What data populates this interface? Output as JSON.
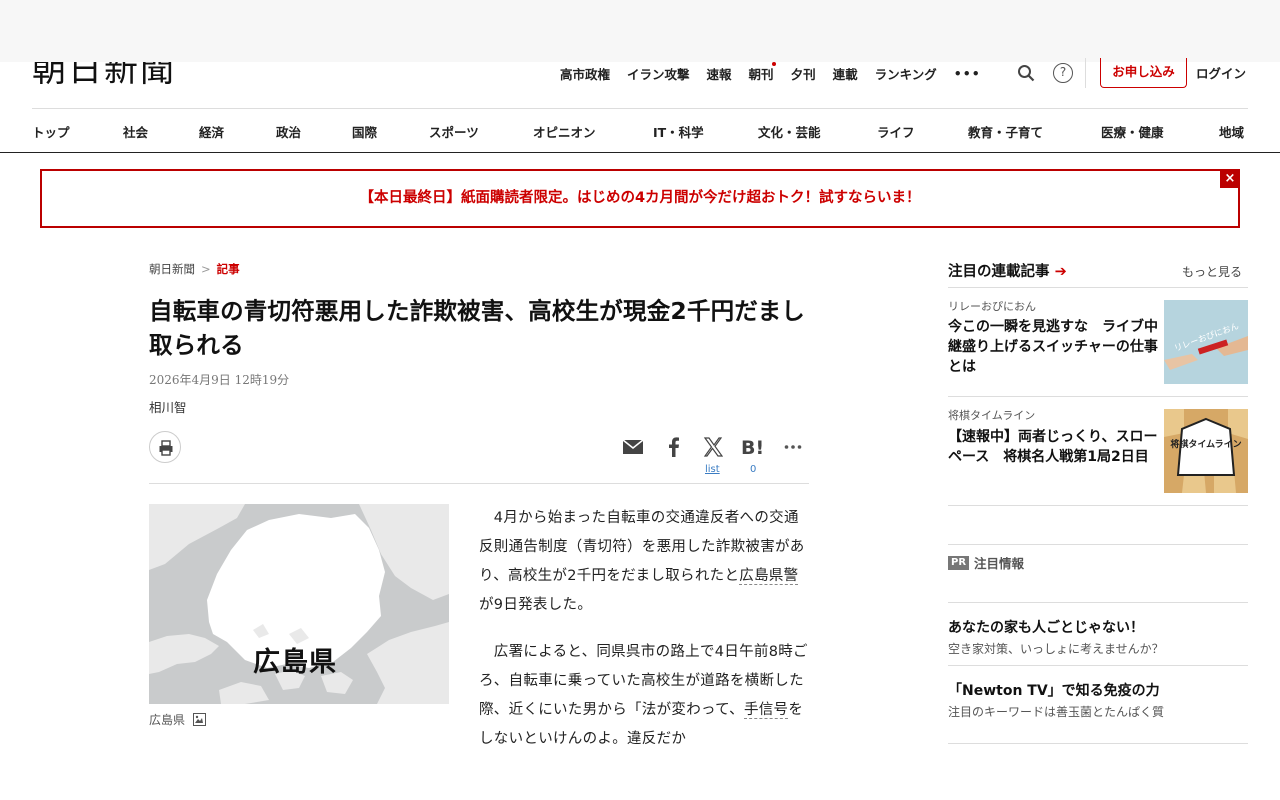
{
  "header": {
    "logo": "朝日新聞",
    "util_nav": [
      "高市政権",
      "イラン攻撃",
      "速報",
      "朝刊",
      "夕刊",
      "連載",
      "ランキング"
    ],
    "more": "•••",
    "help": "?",
    "subscribe": "お申し込み",
    "login": "ログイン"
  },
  "categories": [
    "トップ",
    "社会",
    "経済",
    "政治",
    "国際",
    "スポーツ",
    "オピニオン",
    "IT・科学",
    "文化・芸能",
    "ライフ",
    "教育・子育て",
    "医療・健康",
    "地域"
  ],
  "promo": {
    "text": "【本日最終日】紙面購読者限定。はじめの4カ月間が今だけ超おトク！試すならいま！",
    "close": "×"
  },
  "breadcrumb": {
    "home": "朝日新聞",
    "sep": ">",
    "current": "記事"
  },
  "article": {
    "title": "自転車の青切符悪用した詐欺被害、高校生が現金2千円だまし取られる",
    "date": "2026年4月9日 12時19分",
    "author": "相川智",
    "share": {
      "x_count": "list",
      "hatena_count": "0"
    },
    "map_label": "広島県",
    "caption": "広島県",
    "p1_before": "　4月から始まった自転車の交通違反者への交通反則通告制度（青切符）を悪用した詐欺被害があり、高校生が2千円をだまし取られたと",
    "p1_link": "広島県警",
    "p1_after": "が9日発表した。",
    "p2_before": "　広署によると、同県呉市の路上で4日午前8時ごろ、自転車に乗っていた高校生が道路を横断した際、近くにいた男から「法が変わって、",
    "p2_link": "手信号",
    "p2_after": "をしないといけんのよ。違反だか"
  },
  "sidebar": {
    "heading": "注目の連載記事",
    "heading_arrow": "➔",
    "more": "もっと見る",
    "cards": [
      {
        "label": "リレーおぴにおん",
        "title": "今この一瞬を見逃すな　ライブ中継盛り上げるスイッチャーの仕事とは",
        "thumb_text": "リレーおぴにおん"
      },
      {
        "label": "将棋タイムライン",
        "title": "【速報中】両者じっくり、スローペース　将棋名人戦第1局2日目",
        "thumb_text": "将棋タイムライン"
      }
    ],
    "pr_badge": "PR",
    "pr_heading": "注目情報",
    "ads": [
      {
        "title": "あなたの家も人ごとじゃない！",
        "sub": "空き家対策、いっしょに考えませんか？"
      },
      {
        "title": "「Newton TV」で知る免疫の力",
        "sub": "注目のキーワードは善玉菌とたんぱく質"
      }
    ]
  }
}
